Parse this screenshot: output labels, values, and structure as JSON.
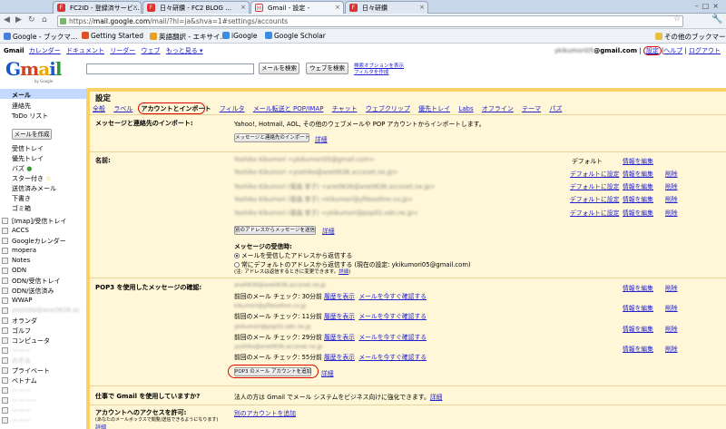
{
  "browser": {
    "tabs": [
      {
        "label": "FC2ID - 登録済サービ…"
      },
      {
        "label": "日々研鑽 - FC2 BLOG …"
      },
      {
        "label": "Gmail - 設定 - "
      },
      {
        "label": "日々研鑽"
      }
    ],
    "url_prefix": "https://",
    "url_host": "mail.google.com",
    "url_path": "/mail/?hl=ja&shva=1#settings/accounts",
    "bookmarks": [
      {
        "label": "Google - ブックマ…",
        "color": "#4a7de0"
      },
      {
        "label": "Getting Started",
        "color": "#e05020"
      },
      {
        "label": "英語翻訳 - エキサイ…",
        "color": "#e8a020"
      },
      {
        "label": "iGoogle",
        "color": "#3a8de0"
      },
      {
        "label": "Google Scholar",
        "color": "#3a8de0"
      }
    ],
    "other_bookmarks": "その他のブックマーク"
  },
  "gmail_bar": {
    "brand": "Gmail",
    "links": [
      "カレンダー",
      "ドキュメント",
      "リーダー",
      "ウェブ",
      "もっと見る ▾"
    ],
    "account": "@gmail.com",
    "settings": "設定",
    "help": "ヘルプ",
    "logout": "ログアウト"
  },
  "logo": {
    "g": "G",
    "m": "m",
    "a": "a",
    "i": "i",
    "l": "l",
    "sub": "by Google"
  },
  "search": {
    "mail_btn": "メールを検索",
    "web_btn": "ウェブを検索",
    "opt1": "検索オプションを表示",
    "opt2": "フィルタを作成"
  },
  "sidebar": {
    "top": [
      "メール",
      "連絡先",
      "ToDo リスト"
    ],
    "compose": "メールを作成",
    "folders": [
      "受信トレイ",
      "優先トレイ",
      "バズ",
      "スター付き",
      "送信済みメール",
      "下書き",
      "ゴミ箱"
    ],
    "labels": [
      "[Imap]/受信トレイ",
      "ACCS",
      "Googleカレンダー",
      "mopera",
      "Notes",
      "ODN",
      "ODN/受信トレイ",
      "ODN/送信済み",
      "WWAP",
      "オランダ",
      "ゴルフ",
      "コンピュータ",
      "プライベート",
      "ベトナム"
    ]
  },
  "settings": {
    "title": "設定",
    "tabs": [
      "全般",
      "ラベル",
      "アカウントとインポート",
      "フィルタ",
      "メール転送と POP/IMAP",
      "チャット",
      "ウェブクリップ",
      "優先トレイ",
      "Labs",
      "オフライン",
      "テーマ",
      "パズ"
    ],
    "import": {
      "label": "メッセージと連絡先のインポート:",
      "desc": "Yahoo!, Hotmail, AOL, その他のウェブメールや POP アカウントからインポートします。",
      "btn": "メッセージと連絡先のインポート",
      "detail": "詳細"
    },
    "name": {
      "label": "名前:",
      "default_label": "デフォルト",
      "set_default": "デフォルトに設定",
      "edit": "情報を編集",
      "delete": "削除",
      "send_btn": "別のアドレスからメッセージを送信",
      "detail": "詳細",
      "reply_title": "メッセージの受信時:",
      "reply_opt1": "メールを受信したアドレスから返信する",
      "reply_opt2": "常にデフォルトのアドレスから返信する (現在の設定: ykikumori05@gmail.com)",
      "note": "(注: アドレスは返信するときに変更できます。",
      "note_detail": "詳細",
      "note_end": ")"
    },
    "pop3": {
      "label": "POP3 を使用したメッセージの確認:",
      "checks": [
        "前回のメール チェック: 30分前",
        "前回のメール チェック: 11分前",
        "前回のメール チェック: 29分前",
        "前回のメール チェック: 55分前"
      ],
      "history": "履歴を表示",
      "check_now": "メールを今すぐ確認する",
      "edit": "情報を編集",
      "delete": "削除",
      "add_btn": "POP3 のメール アカウントを追加",
      "detail": "詳細"
    },
    "work": {
      "label": "仕事で Gmail を使用していますか?",
      "desc": "法人の方は Gmail でメール システムをビジネス向けに強化できます。",
      "detail": "詳細"
    },
    "access": {
      "label": "アカウントへのアクセスを許可:",
      "sub": "(あなたのメールボックスで閲覧/送信できるようになります)",
      "detail": "詳細",
      "link": "別のアカウントを追加"
    }
  }
}
